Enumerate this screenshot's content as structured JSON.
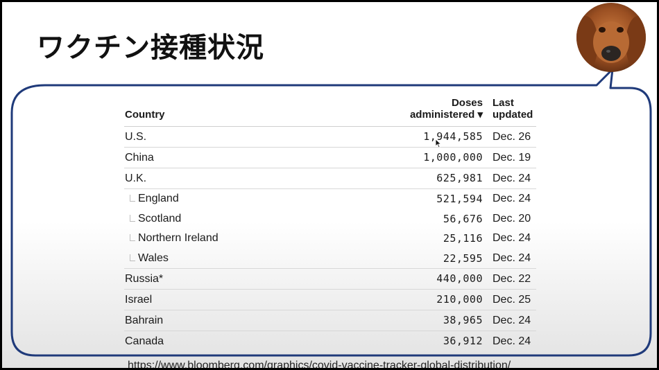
{
  "slide": {
    "title": "ワクチン接種状況",
    "source_url": "https://www.bloomberg.com/graphics/covid-vaccine-tracker-global-distribution/"
  },
  "table": {
    "headers": {
      "country": "Country",
      "doses_line1": "Doses",
      "doses_line2": "administered ▾",
      "updated_line1": "Last",
      "updated_line2": "updated"
    },
    "rows": [
      {
        "country": "U.S.",
        "doses": "1,944,585",
        "updated": "Dec. 26",
        "sub": false
      },
      {
        "country": "China",
        "doses": "1,000,000",
        "updated": "Dec. 19",
        "sub": false
      },
      {
        "country": "U.K.",
        "doses": "625,981",
        "updated": "Dec. 24",
        "sub": false
      },
      {
        "country": "England",
        "doses": "521,594",
        "updated": "Dec. 24",
        "sub": true
      },
      {
        "country": "Scotland",
        "doses": "56,676",
        "updated": "Dec. 20",
        "sub": true
      },
      {
        "country": "Northern Ireland",
        "doses": "25,116",
        "updated": "Dec. 24",
        "sub": true
      },
      {
        "country": "Wales",
        "doses": "22,595",
        "updated": "Dec. 24",
        "sub": true
      },
      {
        "country": "Russia*",
        "doses": "440,000",
        "updated": "Dec. 22",
        "sub": false
      },
      {
        "country": "Israel",
        "doses": "210,000",
        "updated": "Dec. 25",
        "sub": false
      },
      {
        "country": "Bahrain",
        "doses": "38,965",
        "updated": "Dec. 24",
        "sub": false
      },
      {
        "country": "Canada",
        "doses": "36,912",
        "updated": "Dec. 24",
        "sub": false
      }
    ]
  },
  "colors": {
    "bubble_border": "#1f3a7a",
    "text": "#1a1a1a"
  },
  "icons": {
    "avatar": "dog-avatar-icon",
    "cursor": "mouse-cursor-icon"
  }
}
